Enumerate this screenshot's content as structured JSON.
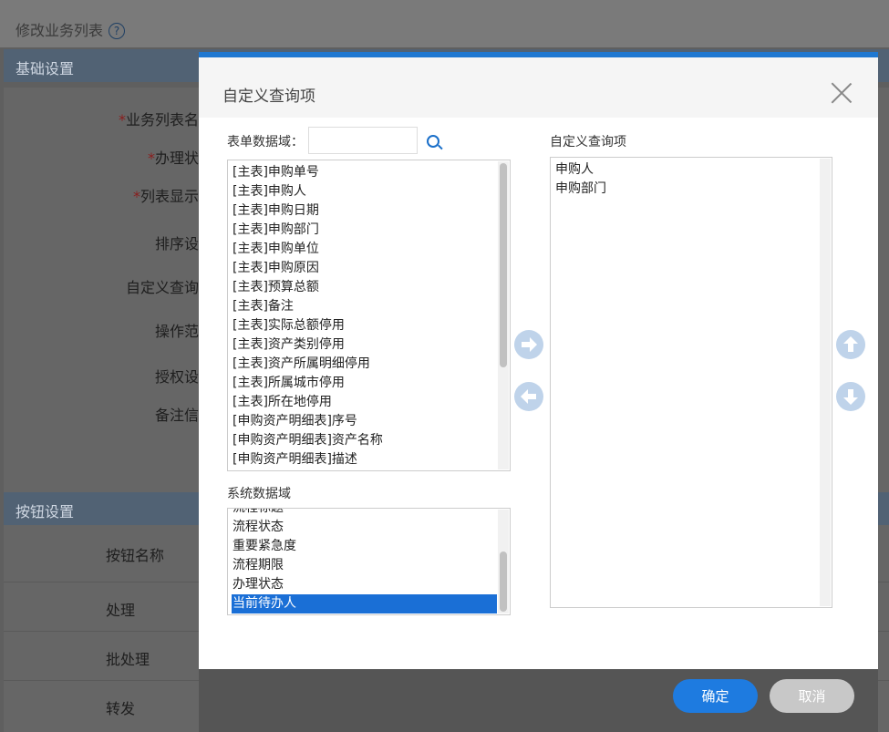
{
  "background": {
    "page_title": "修改业务列表",
    "help_icon_glyph": "?",
    "section_basic": "基础设置",
    "section_buttons": "按钮设置",
    "fields": [
      {
        "req": "*",
        "label": "业务列表名"
      },
      {
        "req": "*",
        "label": "办理状"
      },
      {
        "req": "*",
        "label": "列表显示"
      },
      {
        "req": "",
        "label": "排序设"
      },
      {
        "req": "",
        "label": "自定义查询"
      },
      {
        "req": "",
        "label": "操作范"
      },
      {
        "req": "",
        "label": "授权设"
      },
      {
        "req": "",
        "label": "备注信"
      }
    ],
    "button_col_header": "按钮名称",
    "button_rows": [
      "处理",
      "批处理",
      "转发"
    ]
  },
  "dialog": {
    "title": "自定义查询项",
    "form_domain_label": "表单数据域：",
    "search": {
      "value": "",
      "placeholder": ""
    },
    "form_fields": [
      "[主表]申购单号",
      "[主表]申购人",
      "[主表]申购日期",
      "[主表]申购部门",
      "[主表]申购单位",
      "[主表]申购原因",
      "[主表]预算总额",
      "[主表]备注",
      "[主表]实际总额停用",
      "[主表]资产类别停用",
      "[主表]资产所属明细停用",
      "[主表]所属城市停用",
      "[主表]所在地停用",
      "[申购资产明细表]序号",
      "[申购资产明细表]资产名称",
      "[申购资产明细表]描述"
    ],
    "form_fields_scroll_fraction": 0.0,
    "system_domain_label": "系统数据域",
    "system_fields_partial_top": "流程标题",
    "system_fields": [
      "流程状态",
      "重要紧急度",
      "流程期限",
      "办理状态",
      "当前待办人"
    ],
    "system_selected_index": 4,
    "custom_label": "自定义查询项",
    "custom_items": [
      "申购人",
      "申购部门"
    ],
    "ok_label": "确定",
    "cancel_label": "取消",
    "colors": {
      "accent": "#1e7be0",
      "arrow_button": "#bfd3ea",
      "selected_row": "#1a6fd6",
      "footer": "#555555"
    }
  }
}
